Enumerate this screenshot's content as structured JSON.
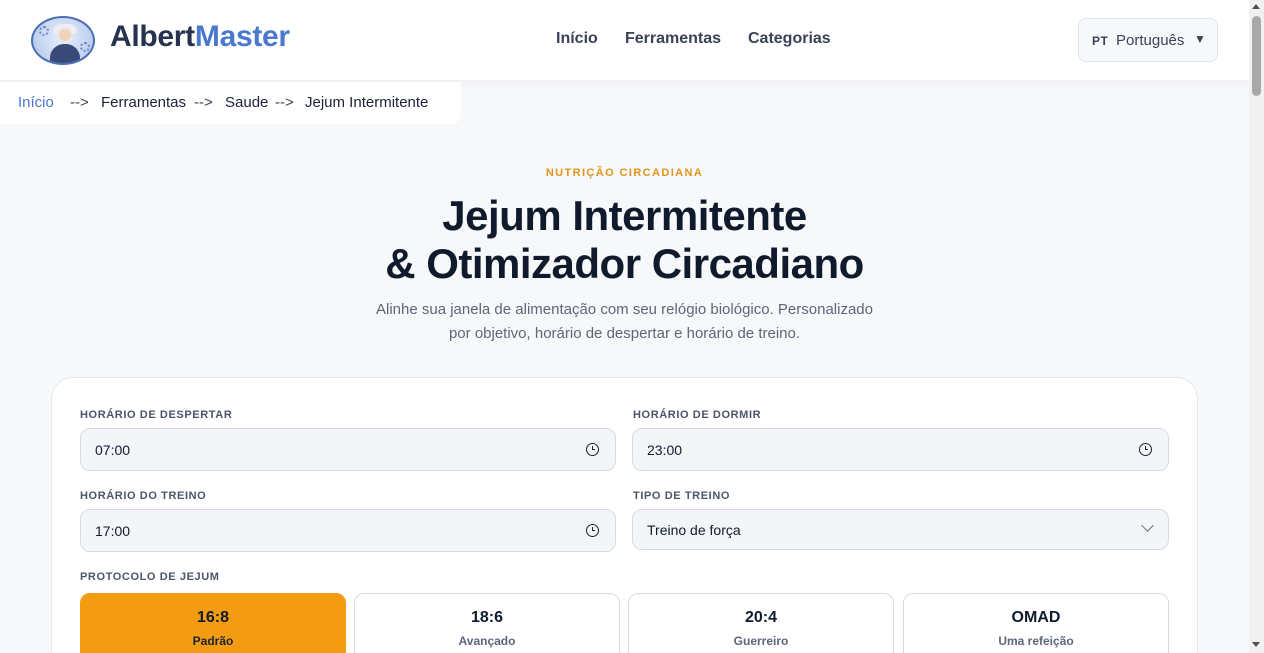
{
  "header": {
    "brand_part1": "Albert",
    "brand_part2": "Master",
    "nav": [
      "Início",
      "Ferramentas",
      "Categorias"
    ],
    "lang_code": "PT",
    "lang_name": "Português"
  },
  "breadcrumb": [
    "Início",
    "Ferramentas",
    "Saude",
    "Jejum Intermitente"
  ],
  "breadcrumb_sep": "-->",
  "hero": {
    "eyebrow": "NUTRIÇÃO CIRCADIANA",
    "title_line1": "Jejum Intermitente",
    "title_line2": "& Otimizador Circadiano",
    "subtitle_line1": "Alinhe sua janela de alimentação com seu relógio biológico. Personalizado",
    "subtitle_line2": "por objetivo, horário de despertar e horário de treino."
  },
  "form": {
    "wake_label": "HORÁRIO DE DESPERTAR",
    "wake_value": "07:00",
    "sleep_label": "HORÁRIO DE DORMIR",
    "sleep_value": "23:00",
    "train_label": "HORÁRIO DO TREINO",
    "train_value": "17:00",
    "type_label": "TIPO DE TREINO",
    "type_value": "Treino de força",
    "protocol_label": "PROTOCOLO DE JEJUM",
    "protocols": [
      {
        "title": "16:8",
        "subtitle": "Padrão",
        "active": true
      },
      {
        "title": "18:6",
        "subtitle": "Avançado",
        "active": false
      },
      {
        "title": "20:4",
        "subtitle": "Guerreiro",
        "active": false
      },
      {
        "title": "OMAD",
        "subtitle": "Uma refeição",
        "active": false
      }
    ]
  },
  "colors": {
    "accent": "#f39c12",
    "brand_blue": "#4a78cf",
    "brand_dark": "#26324f"
  }
}
